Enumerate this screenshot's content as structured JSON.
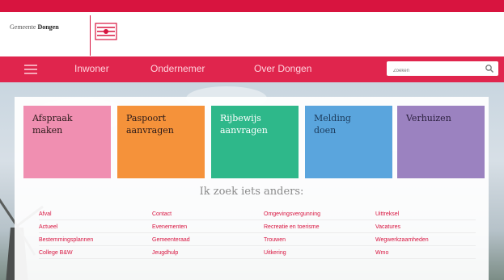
{
  "header": {
    "logo_prefix": "Gemeente",
    "logo_name": "Dongen"
  },
  "nav": {
    "items": [
      {
        "label": "Inwoner"
      },
      {
        "label": "Ondernemer"
      },
      {
        "label": "Over Dongen"
      }
    ],
    "search_placeholder": "Zoeken"
  },
  "tiles": [
    {
      "line1": "Afspraak",
      "line2": "maken",
      "color": "#f08fb1"
    },
    {
      "line1": "Paspoort",
      "line2": "aanvragen",
      "color": "#f5923a"
    },
    {
      "line1": "Rijbewijs",
      "line2": "aanvragen",
      "color": "#2eb88a"
    },
    {
      "line1": "Melding",
      "line2": "doen",
      "color": "#5aa5dd"
    },
    {
      "line1": "Verhuizen",
      "line2": "",
      "color": "#9b82c0"
    }
  ],
  "section": {
    "heading": "Ik zoek iets anders:"
  },
  "links": [
    [
      "Afval",
      "Contact",
      "Omgevingsvergunning",
      "Uittreksel"
    ],
    [
      "Actueel",
      "Evenementen",
      "Recreatie en toerisme",
      "Vacatures"
    ],
    [
      "Bestemmingsplannen",
      "Gemeenteraad",
      "Trouwen",
      "Wegwerkzaamheden"
    ],
    [
      "College B&W",
      "Jeugdhulp",
      "Uitkering",
      "Wmo"
    ]
  ],
  "colors": {
    "brand": "#d8143f",
    "navbar": "#e0254d"
  }
}
